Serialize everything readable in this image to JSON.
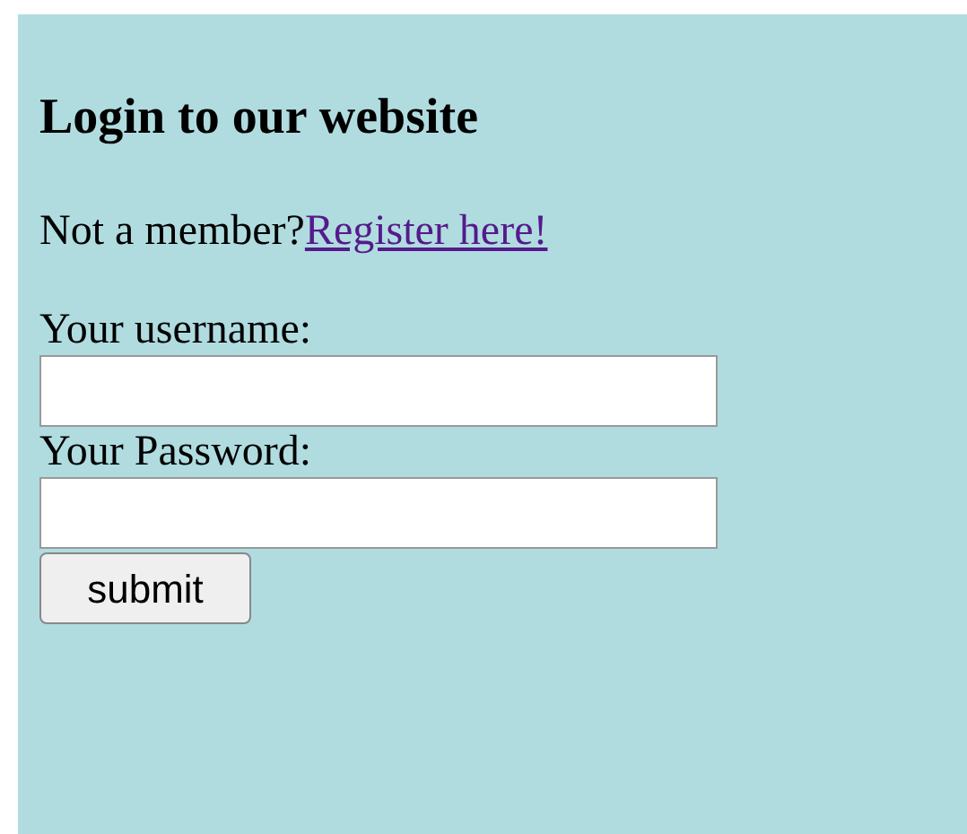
{
  "heading": "Login to our website",
  "member_prompt": {
    "text": "Not a member?",
    "link": "Register here!"
  },
  "fields": [
    {
      "label": "Your username:"
    },
    {
      "label": "Your Password:"
    }
  ],
  "submit_button": "submit"
}
